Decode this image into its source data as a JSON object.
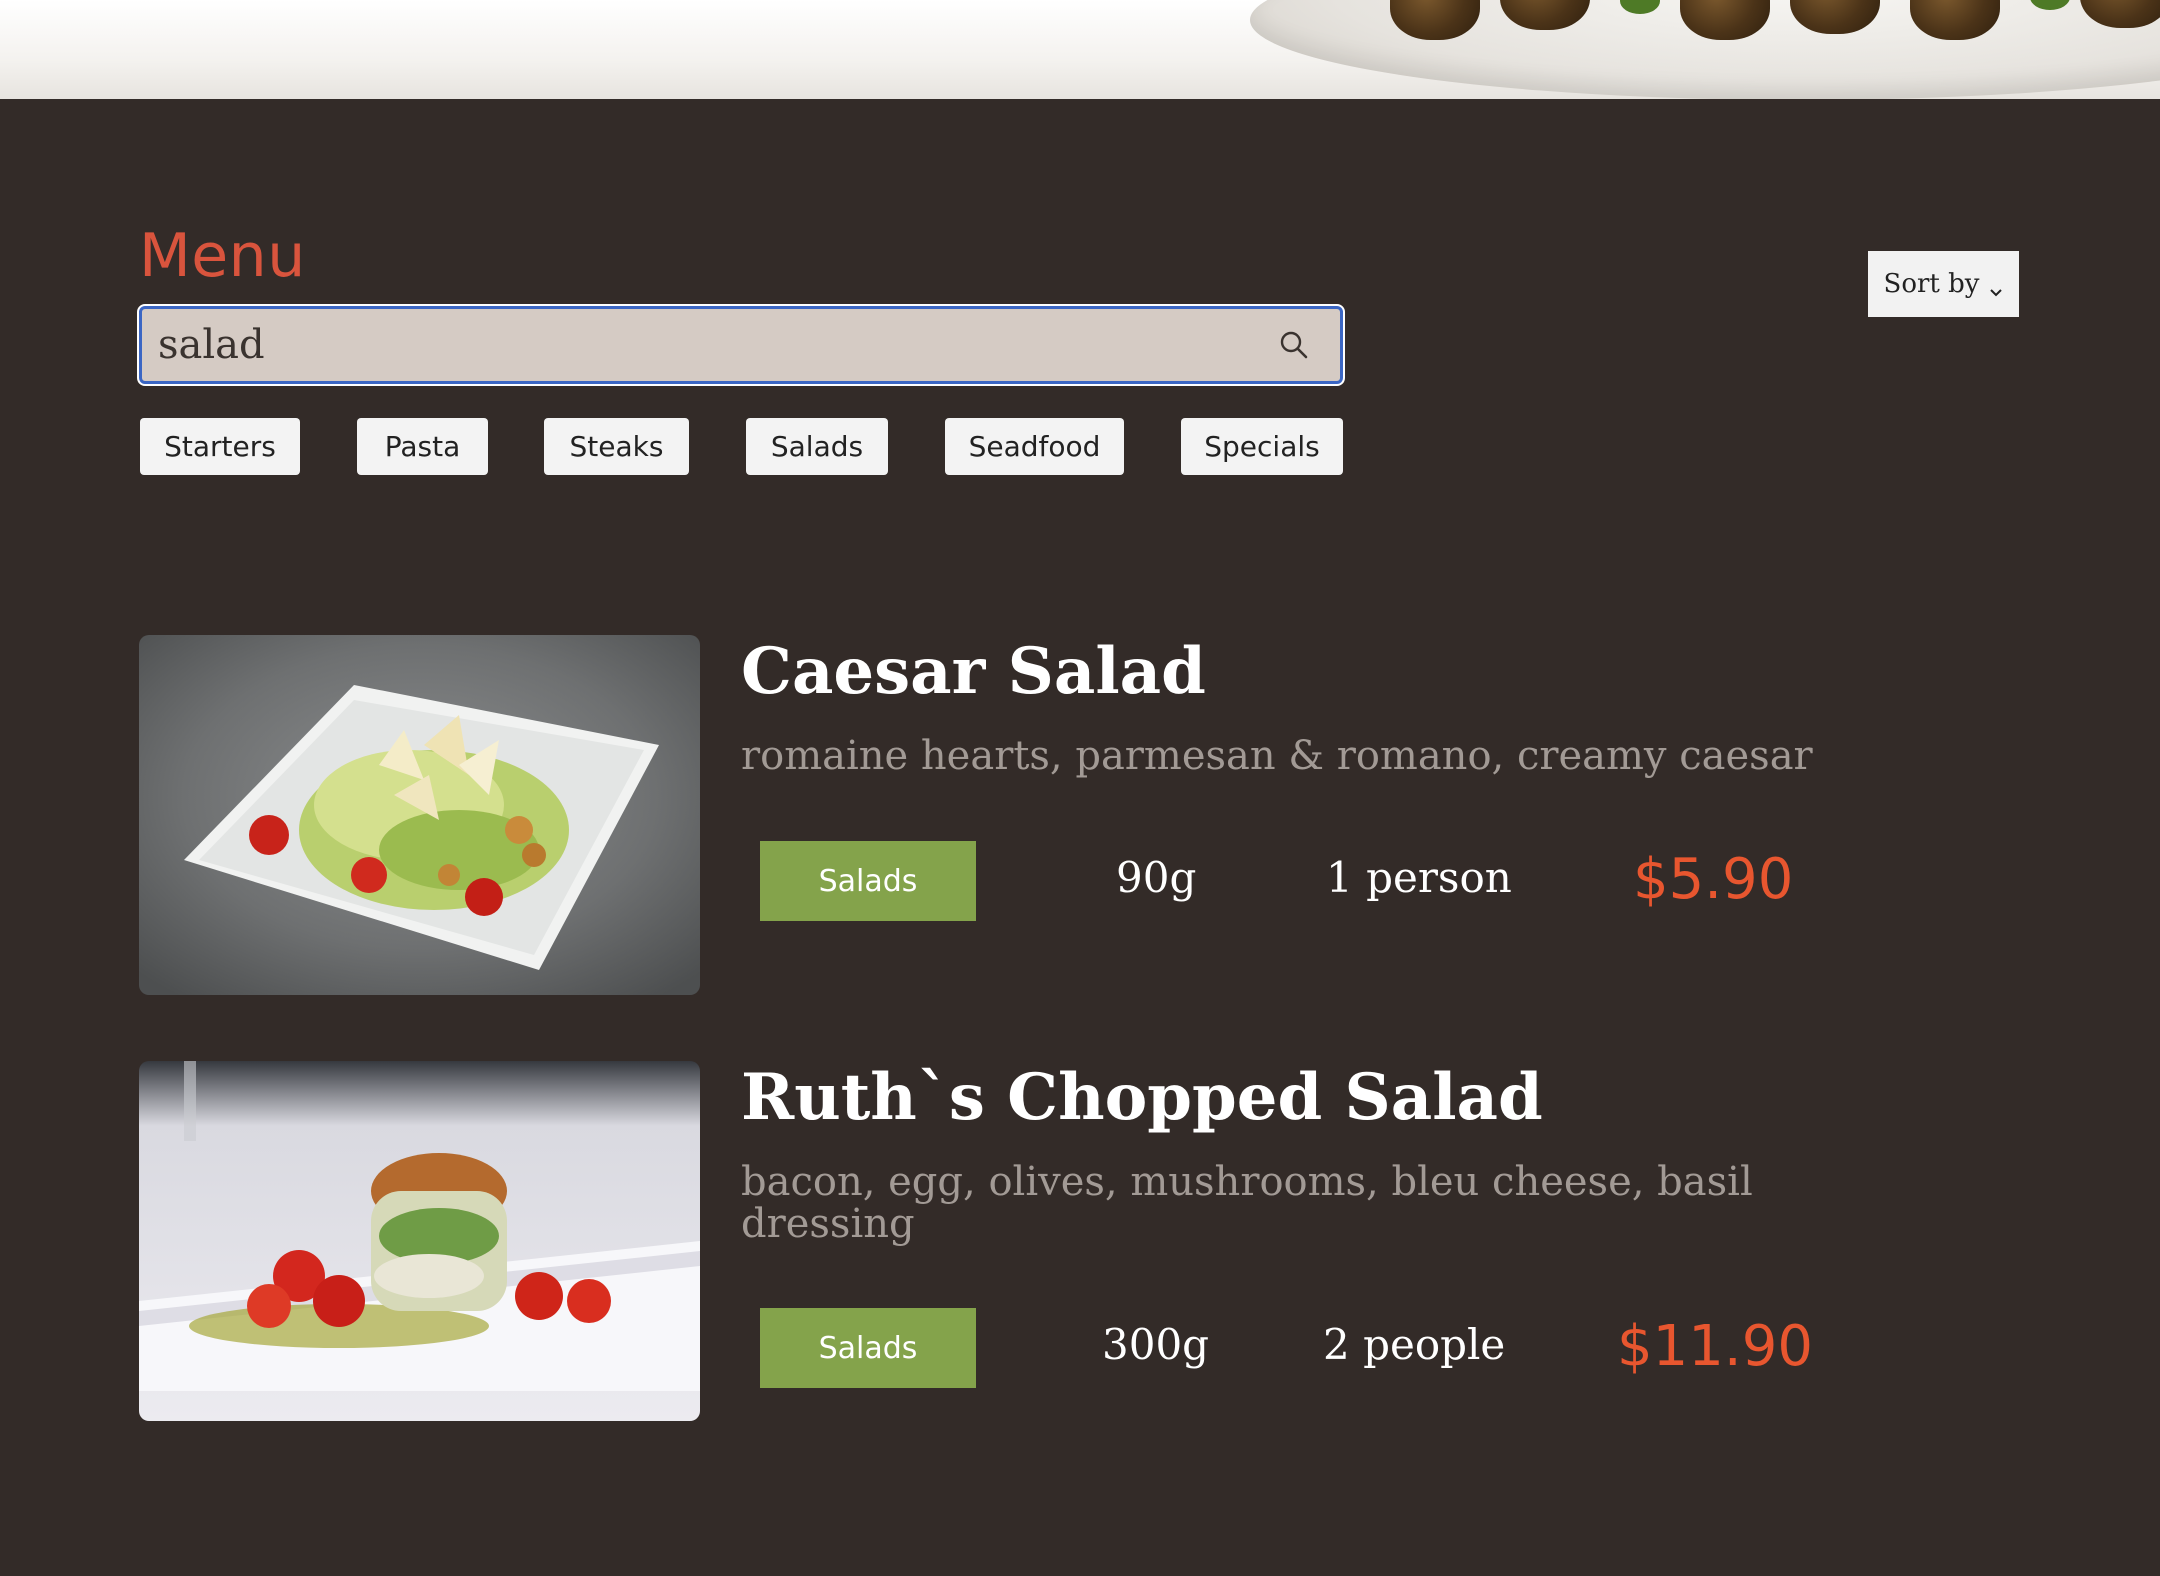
{
  "menu": {
    "title": "Menu"
  },
  "search": {
    "value": "salad",
    "placeholder": "Search"
  },
  "sort": {
    "label": "Sort by"
  },
  "filters": [
    {
      "label": "Starters"
    },
    {
      "label": "Pasta"
    },
    {
      "label": "Steaks"
    },
    {
      "label": "Salads"
    },
    {
      "label": "Seadfood"
    },
    {
      "label": "Specials"
    }
  ],
  "items": [
    {
      "name": "Caesar Salad",
      "description": "romaine hearts, parmesan & romano, creamy caesar",
      "category": "Salads",
      "weight": "90g",
      "serves": "1 person",
      "price": "$5.90",
      "image": "caesar-salad-photo"
    },
    {
      "name": "Ruth`s Chopped Salad",
      "description": "bacon, egg, olives, mushrooms, bleu cheese, basil dressing",
      "category": "Salads",
      "weight": "300g",
      "serves": "2  people",
      "price": "$11.90",
      "image": "chopped-salad-photo"
    }
  ],
  "colors": {
    "background": "#332b28",
    "accent": "#d9543d",
    "price": "#e8562f",
    "category_badge": "#84a34b",
    "search_bg": "#d5cbc4",
    "search_focus": "#3b66c4"
  }
}
